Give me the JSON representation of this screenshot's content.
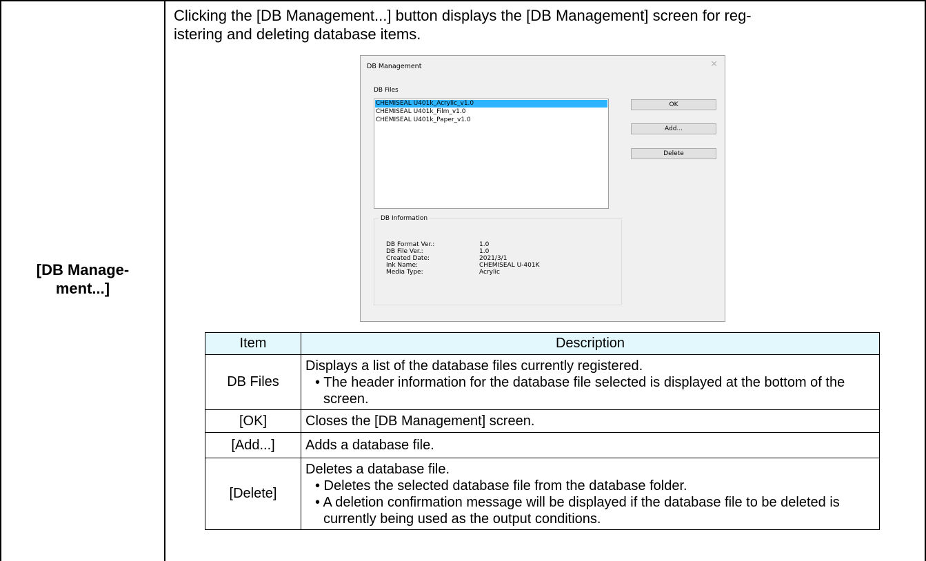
{
  "left_label": "[DB Manage-\nment...]",
  "intro_text": "Clicking the [DB Management...] button displays the [DB Management] screen for reg-istering and deleting database items.",
  "intro_line1": "Clicking the [DB Management...] button displays the [DB Management] screen for reg-",
  "intro_line2": "istering and deleting database items.",
  "dialog": {
    "title": "DB Management",
    "close_glyph": "✕",
    "files_label": "DB Files",
    "files": [
      "CHEMISEAL U401k_Acrylic_v1.0",
      "CHEMISEAL U401k_Film_v1.0",
      "CHEMISEAL U401k_Paper_v1.0"
    ],
    "selected_index": 0,
    "buttons": {
      "ok": "OK",
      "add": "Add...",
      "delete": "Delete"
    },
    "info_title": "DB Information",
    "info": [
      {
        "key": "DB Format Ver.:",
        "value": "1.0"
      },
      {
        "key": "DB File Ver.:",
        "value": "1.0"
      },
      {
        "key": "Created Date:",
        "value": "2021/3/1"
      },
      {
        "key": "Ink Name:",
        "value": "CHEMISEAL U-401K"
      },
      {
        "key": "Media Type:",
        "value": "Acrylic"
      }
    ],
    "selection_color": "#2cb4ff"
  },
  "table": {
    "headers": [
      "Item",
      "Description"
    ],
    "header_bg": "#e3f8fd",
    "rows": [
      {
        "item": "DB Files",
        "text": "Displays a list of the database files currently registered.",
        "bullets": [
          "• The header information for the database file selected is displayed at the bottom of the screen."
        ]
      },
      {
        "item": "[OK]",
        "text": "Closes the [DB Management] screen.",
        "bullets": []
      },
      {
        "item": "[Add...]",
        "text": "Adds a database file.",
        "bullets": []
      },
      {
        "item": "[Delete]",
        "text": "Deletes a database file.",
        "bullets": [
          "• Deletes the selected database file from the database folder.",
          "• A deletion confirmation message will be displayed if the database file to be deleted is currently being used as the output conditions."
        ]
      }
    ]
  }
}
